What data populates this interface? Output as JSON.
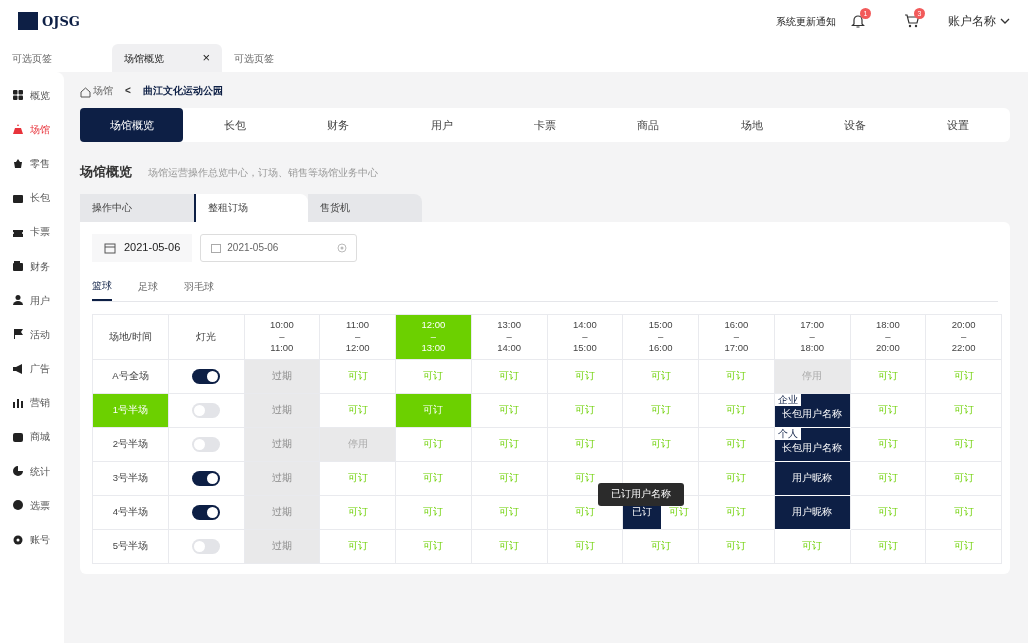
{
  "header": {
    "logo_text": "OJSG",
    "notice": "系统更新通知",
    "bell_badge": "1",
    "cart_badge": "3",
    "account": "账户名称"
  },
  "page_tabs": [
    {
      "label": "可选页签",
      "selected": false,
      "closable": false
    },
    {
      "label": "场馆概览",
      "selected": true,
      "closable": true
    },
    {
      "label": "可选页签",
      "selected": false,
      "closable": false
    }
  ],
  "close_glyph": "×",
  "sidebar": [
    {
      "label": "概览",
      "selected": false
    },
    {
      "label": "场馆",
      "selected": true
    },
    {
      "label": "零售",
      "selected": false
    },
    {
      "label": "长包",
      "selected": false
    },
    {
      "label": "卡票",
      "selected": false
    },
    {
      "label": "财务",
      "selected": false
    },
    {
      "label": "用户",
      "selected": false
    },
    {
      "label": "活动",
      "selected": false
    },
    {
      "label": "广告",
      "selected": false
    },
    {
      "label": "营销",
      "selected": false
    },
    {
      "label": "商城",
      "selected": false
    },
    {
      "label": "统计",
      "selected": false
    },
    {
      "label": "选票",
      "selected": false
    },
    {
      "label": "账号",
      "selected": false
    }
  ],
  "breadcrumb": {
    "home": "场馆",
    "back": "<",
    "current": "曲江文化运动公园"
  },
  "main_tabs": [
    {
      "label": "场馆概览",
      "selected": true
    },
    {
      "label": "长包",
      "selected": false
    },
    {
      "label": "财务",
      "selected": false
    },
    {
      "label": "用户",
      "selected": false
    },
    {
      "label": "卡票",
      "selected": false
    },
    {
      "label": "商品",
      "selected": false
    },
    {
      "label": "场地",
      "selected": false
    },
    {
      "label": "设备",
      "selected": false
    },
    {
      "label": "设置",
      "selected": false
    }
  ],
  "section": {
    "title": "场馆概览",
    "subtitle": "场馆运营操作总览中心，订场、销售等场馆业务中心"
  },
  "sub_tabs": [
    {
      "label": "操作中心",
      "selected": false
    },
    {
      "label": "整租订场",
      "selected": true
    },
    {
      "label": "售货机",
      "selected": false
    }
  ],
  "date_button": "2021-05-06",
  "date_field": {
    "value": "2021-05-06"
  },
  "sport_tabs": [
    {
      "label": "篮球",
      "selected": true
    },
    {
      "label": "足球",
      "selected": false
    },
    {
      "label": "羽毛球",
      "selected": false
    }
  ],
  "table": {
    "field_header": "场地/时间",
    "light_header": "灯光",
    "slots": [
      {
        "from": "10:00",
        "sep": "–",
        "to": "11:00",
        "selected": false
      },
      {
        "from": "11:00",
        "sep": "–",
        "to": "12:00",
        "selected": false
      },
      {
        "from": "12:00",
        "sep": "–",
        "to": "13:00",
        "selected": true
      },
      {
        "from": "13:00",
        "sep": "–",
        "to": "14:00",
        "selected": false
      },
      {
        "from": "14:00",
        "sep": "–",
        "to": "15:00",
        "selected": false
      },
      {
        "from": "15:00",
        "sep": "–",
        "to": "16:00",
        "selected": false
      },
      {
        "from": "16:00",
        "sep": "–",
        "to": "17:00",
        "selected": false
      },
      {
        "from": "17:00",
        "sep": "–",
        "to": "18:00",
        "selected": false
      },
      {
        "from": "18:00",
        "sep": "–",
        "to": "20:00",
        "selected": false
      },
      {
        "from": "20:00",
        "sep": "–",
        "to": "22:00",
        "selected": false
      }
    ],
    "rows": [
      {
        "name": "A号全场",
        "selected": false,
        "light_on": true,
        "cells": [
          {
            "kind": "expired",
            "text": "过期"
          },
          {
            "kind": "available",
            "text": "可订"
          },
          {
            "kind": "available",
            "text": "可订"
          },
          {
            "kind": "available",
            "text": "可订"
          },
          {
            "kind": "available",
            "text": "可订"
          },
          {
            "kind": "available",
            "text": "可订"
          },
          {
            "kind": "available",
            "text": "可订"
          },
          {
            "kind": "disabled",
            "text": "停用"
          },
          {
            "kind": "available",
            "text": "可订"
          },
          {
            "kind": "available",
            "text": "可订"
          }
        ]
      },
      {
        "name": "1号半场",
        "selected": true,
        "light_on": false,
        "cells": [
          {
            "kind": "expired",
            "text": "过期"
          },
          {
            "kind": "available",
            "text": "可订"
          },
          {
            "kind": "selected",
            "text": "可订"
          },
          {
            "kind": "available",
            "text": "可订"
          },
          {
            "kind": "available",
            "text": "可订"
          },
          {
            "kind": "available",
            "text": "可订"
          },
          {
            "kind": "available",
            "text": "可订"
          },
          {
            "kind": "booked",
            "text": "长包用户名称",
            "tag": "企业"
          },
          {
            "kind": "available",
            "text": "可订"
          },
          {
            "kind": "available",
            "text": "可订"
          }
        ]
      },
      {
        "name": "2号半场",
        "selected": false,
        "light_on": false,
        "cells": [
          {
            "kind": "expired",
            "text": "过期"
          },
          {
            "kind": "disabled",
            "text": "停用"
          },
          {
            "kind": "available",
            "text": "可订"
          },
          {
            "kind": "available",
            "text": "可订"
          },
          {
            "kind": "available",
            "text": "可订"
          },
          {
            "kind": "available",
            "text": "可订"
          },
          {
            "kind": "available",
            "text": "可订"
          },
          {
            "kind": "booked",
            "text": "长包用户名称",
            "tag": "个人"
          },
          {
            "kind": "available",
            "text": "可订"
          },
          {
            "kind": "available",
            "text": "可订"
          }
        ]
      },
      {
        "name": "3号半场",
        "selected": false,
        "light_on": true,
        "cells": [
          {
            "kind": "expired",
            "text": "过期"
          },
          {
            "kind": "available",
            "text": "可订"
          },
          {
            "kind": "available",
            "text": "可订"
          },
          {
            "kind": "available",
            "text": "可订"
          },
          {
            "kind": "available",
            "text": "可订"
          },
          {
            "kind": "blank"
          },
          {
            "kind": "available",
            "text": "可订"
          },
          {
            "kind": "booked",
            "text": "用户昵称"
          },
          {
            "kind": "available",
            "text": "可订"
          },
          {
            "kind": "available",
            "text": "可订"
          }
        ]
      },
      {
        "name": "4号半场",
        "selected": false,
        "light_on": true,
        "cells": [
          {
            "kind": "expired",
            "text": "过期"
          },
          {
            "kind": "available",
            "text": "可订"
          },
          {
            "kind": "available",
            "text": "可订"
          },
          {
            "kind": "available",
            "text": "可订"
          },
          {
            "kind": "available",
            "text": "可订"
          },
          {
            "kind": "split",
            "parts": [
              {
                "kind": "booked",
                "text": "已订"
              },
              {
                "kind": "available",
                "text": "可订"
              }
            ],
            "tooltip": "已订用户名称"
          },
          {
            "kind": "available",
            "text": "可订"
          },
          {
            "kind": "booked",
            "text": "用户昵称"
          },
          {
            "kind": "available",
            "text": "可订"
          },
          {
            "kind": "available",
            "text": "可订"
          }
        ]
      },
      {
        "name": "5号半场",
        "selected": false,
        "light_on": false,
        "cells": [
          {
            "kind": "expired",
            "text": "过期"
          },
          {
            "kind": "available",
            "text": "可订"
          },
          {
            "kind": "available",
            "text": "可订"
          },
          {
            "kind": "available",
            "text": "可订"
          },
          {
            "kind": "available",
            "text": "可订"
          },
          {
            "kind": "available",
            "text": "可订"
          },
          {
            "kind": "available",
            "text": "可订"
          },
          {
            "kind": "available",
            "text": "可订"
          },
          {
            "kind": "available",
            "text": "可订"
          },
          {
            "kind": "available",
            "text": "可订"
          }
        ]
      }
    ]
  }
}
